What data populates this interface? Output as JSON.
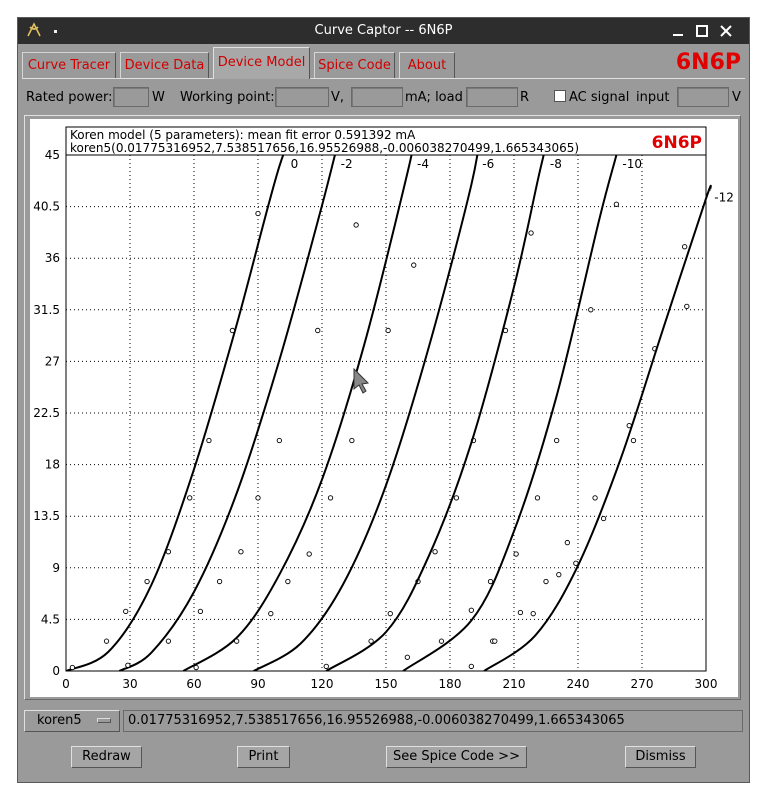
{
  "window": {
    "title": "Curve Captor -- 6N6P",
    "app_icon": "app-logo-icon",
    "controls": [
      "menu-dot-icon",
      "minimize-icon",
      "maximize-icon",
      "close-icon"
    ]
  },
  "tabs": [
    {
      "label": "Curve Tracer",
      "active": false
    },
    {
      "label": "Device Data",
      "active": false
    },
    {
      "label": "Device Model",
      "active": true
    },
    {
      "label": "Spice Code",
      "active": false
    },
    {
      "label": "About",
      "active": false
    }
  ],
  "device_name": "6N6P",
  "params": {
    "rated_power_label": "Rated power:",
    "rated_power_unit": "W",
    "rated_power_value": "",
    "working_point_label": "Working point:",
    "wp_volts_value": "",
    "wp_volts_unit": "V,",
    "wp_ma_value": "",
    "wp_ma_unit": "mA; load",
    "load_value": "",
    "load_unit": "R",
    "ac_signal_label": "AC signal",
    "ac_signal_checked": false,
    "input_label": "input",
    "input_value": "",
    "input_unit": "V"
  },
  "plot": {
    "header_line1": "Koren model (5 parameters): mean fit error 0.591392 mA",
    "header_line2": "koren5(0.01775316952,7.538517656,16.95526988,-0.006038270499,1.665343065)",
    "device_label": "6N6P"
  },
  "chart_data": {
    "type": "line",
    "xlim": [
      0,
      300
    ],
    "ylim": [
      0,
      45
    ],
    "x_ticks": [
      "0",
      "30",
      "60",
      "90",
      "120",
      "150",
      "180",
      "210",
      "240",
      "270",
      "300"
    ],
    "y_ticks": [
      "0",
      "4.5",
      "9",
      "13.5",
      "18",
      "22.5",
      "27",
      "31.5",
      "36",
      "40.5",
      "45"
    ],
    "grid": true,
    "series": [
      {
        "name": "0",
        "model": [
          [
            0,
            0
          ],
          [
            20,
            1.7
          ],
          [
            40,
            7.5
          ],
          [
            60,
            17.6
          ],
          [
            80,
            30.2
          ],
          [
            100,
            44
          ],
          [
            110,
            48
          ]
        ],
        "points": [
          [
            3,
            0.3
          ],
          [
            19,
            2.6
          ],
          [
            28,
            5.2
          ],
          [
            38,
            7.8
          ],
          [
            48,
            10.4
          ],
          [
            58,
            15.1
          ],
          [
            67,
            20.1
          ],
          [
            78,
            29.7
          ],
          [
            90,
            39.9
          ]
        ]
      },
      {
        "name": "-2",
        "model": [
          [
            25,
            0
          ],
          [
            40,
            1.6
          ],
          [
            60,
            6.9
          ],
          [
            80,
            15.5
          ],
          [
            100,
            27.1
          ],
          [
            120,
            40.6
          ],
          [
            130,
            48
          ]
        ],
        "points": [
          [
            29,
            0.5
          ],
          [
            48,
            2.6
          ],
          [
            63,
            5.2
          ],
          [
            72,
            7.8
          ],
          [
            82,
            10.4
          ],
          [
            90,
            15.1
          ],
          [
            100,
            20.1
          ],
          [
            118,
            29.7
          ],
          [
            136,
            38.9
          ]
        ]
      },
      {
        "name": "-4",
        "model": [
          [
            55,
            0
          ],
          [
            80,
            2.9
          ],
          [
            100,
            8.4
          ],
          [
            120,
            16.7
          ],
          [
            140,
            28.6
          ],
          [
            160,
            43.4
          ],
          [
            165,
            48
          ]
        ],
        "points": [
          [
            61,
            0.3
          ],
          [
            80,
            2.6
          ],
          [
            96,
            5.0
          ],
          [
            104,
            7.8
          ],
          [
            114,
            10.2
          ],
          [
            124,
            15.1
          ],
          [
            134,
            20.1
          ],
          [
            151,
            29.7
          ],
          [
            163,
            35.4
          ]
        ]
      },
      {
        "name": "-6",
        "model": [
          [
            88,
            0
          ],
          [
            110,
            2.4
          ],
          [
            130,
            7.6
          ],
          [
            150,
            16.2
          ],
          [
            170,
            28.2
          ],
          [
            190,
            42.4
          ],
          [
            195,
            48
          ]
        ],
        "points": [
          [
            122,
            0.4
          ],
          [
            143,
            2.6
          ],
          [
            152,
            5.0
          ],
          [
            165,
            7.8
          ],
          [
            173,
            10.4
          ],
          [
            183,
            15.1
          ],
          [
            191,
            20.1
          ],
          [
            206,
            29.7
          ],
          [
            218,
            38.2
          ]
        ]
      },
      {
        "name": "-8",
        "model": [
          [
            122,
            0
          ],
          [
            150,
            3.4
          ],
          [
            170,
            10.0
          ],
          [
            190,
            19.9
          ],
          [
            210,
            33.5
          ],
          [
            222,
            43.5
          ],
          [
            228,
            48
          ]
        ],
        "points": [
          [
            160,
            1.2
          ],
          [
            176,
            2.6
          ],
          [
            190,
            5.3
          ],
          [
            199,
            7.8
          ],
          [
            211,
            10.2
          ],
          [
            221,
            15.1
          ],
          [
            230,
            20.1
          ],
          [
            246,
            31.5
          ],
          [
            258,
            40.7
          ]
        ]
      },
      {
        "name": "-10",
        "model": [
          [
            158,
            0
          ],
          [
            190,
            4.4
          ],
          [
            210,
            12.2
          ],
          [
            230,
            24.0
          ],
          [
            250,
            39.4
          ],
          [
            258,
            45
          ],
          [
            262,
            48
          ]
        ],
        "points": [
          [
            190,
            0.4
          ],
          [
            200,
            2.6
          ],
          [
            213,
            5.1
          ],
          [
            225,
            7.8
          ],
          [
            235,
            11.2
          ],
          [
            248,
            15.1
          ],
          [
            264,
            21.4
          ],
          [
            276,
            28.1
          ],
          [
            290,
            37.0
          ]
        ]
      },
      {
        "name": "-12",
        "model": [
          [
            196,
            0
          ],
          [
            220,
            3.1
          ],
          [
            240,
            9.2
          ],
          [
            260,
            18.5
          ],
          [
            280,
            29.9
          ],
          [
            300,
            41.2
          ],
          [
            302,
            42
          ]
        ],
        "points": [
          [
            201,
            2.6
          ],
          [
            219,
            5.0
          ],
          [
            231,
            8.4
          ],
          [
            239,
            9.4
          ],
          [
            252,
            13.3
          ],
          [
            266,
            20.1
          ],
          [
            291,
            31.8
          ]
        ]
      }
    ]
  },
  "bottom": {
    "model_select": "koren5",
    "coefficients": "0.01775316952,7.538517656,16.95526988,-0.006038270499,1.665343065"
  },
  "buttons": {
    "redraw": "Redraw",
    "print": "Print",
    "see_spice": "See Spice Code >>",
    "dismiss": "Dismiss"
  }
}
